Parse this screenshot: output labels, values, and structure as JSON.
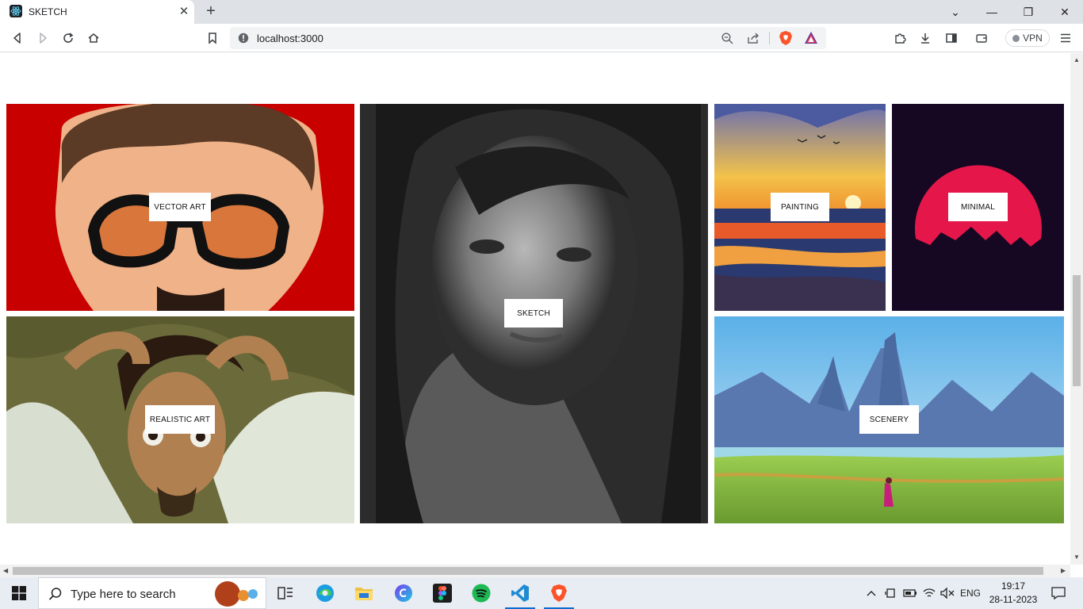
{
  "browser": {
    "tab_title": "SKETCH",
    "url": "localhost:3000",
    "vpn_label": "VPN",
    "accent": "#dee1e6"
  },
  "gallery": {
    "tiles": [
      {
        "label": "VECTOR ART"
      },
      {
        "label": "SKETCH"
      },
      {
        "label": "PAINTING"
      },
      {
        "label": "MINIMAL"
      },
      {
        "label": "REALISTIC ART"
      },
      {
        "label": "SCENERY"
      }
    ]
  },
  "taskbar": {
    "search_placeholder": "Type here to search",
    "lang": "ENG",
    "time": "19:17",
    "date": "28-11-2023",
    "apps": [
      "task-view-icon",
      "edge-icon",
      "file-explorer-icon",
      "canva-icon",
      "figma-icon",
      "spotify-icon",
      "vscode-icon",
      "brave-icon"
    ]
  }
}
